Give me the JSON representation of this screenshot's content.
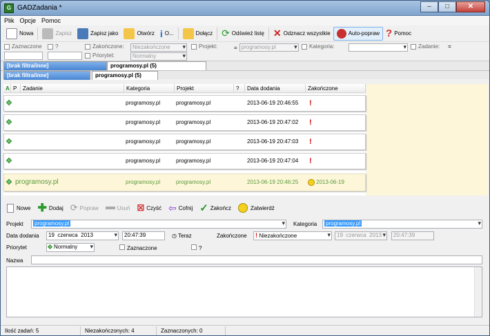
{
  "window": {
    "title": "GADZadania *",
    "controls": {
      "minimize": "–",
      "maximize": "□",
      "close": "✕"
    }
  },
  "menu": [
    "Plik",
    "Opcje",
    "Pomoc"
  ],
  "toolbar": {
    "new": "Nowa",
    "save": "Zapisz",
    "save_as": "Zapisz jako",
    "open": "Otwórz",
    "about": "O...",
    "attach": "Dołącz",
    "refresh": "Odśwież listę",
    "mark_all": "Odznacz wszystkie",
    "autocorrect": "Auto-popraw",
    "help": "Pomoc"
  },
  "filters": {
    "checked_label": "Zaznaczone",
    "question_label": "?",
    "finished_label": "Zakończone:",
    "finished_value": "Niezakończone",
    "project_label": "Projekt:",
    "project_eq": "=",
    "project_value": "programosy.pl",
    "category_label": "Kategoria:",
    "task_label": "Zadanie:",
    "task_eq": "=",
    "priority_label": "Priorytet:",
    "priority_value": "Normalny"
  },
  "tabs_outer": [
    "[brak filtra/inne]",
    "programosy.pl (5)"
  ],
  "tabs_inner": [
    "[brak filtra/inne]",
    "programosy.pl (5)"
  ],
  "columns": [
    "A",
    "P",
    "Zadanie",
    "Kategoria",
    "Projekt",
    "?",
    "Data dodania",
    "Zakończone"
  ],
  "rows": [
    {
      "task": "",
      "category": "programosy.pl",
      "project": "programosy.pl",
      "added": "2013-06-19 20:46:55",
      "finished": "!"
    },
    {
      "task": "",
      "category": "programosy.pl",
      "project": "programosy.pl",
      "added": "2013-06-19 20:47:02",
      "finished": "!"
    },
    {
      "task": "",
      "category": "programosy.pl",
      "project": "programosy.pl",
      "added": "2013-06-19 20:47:03",
      "finished": "!"
    },
    {
      "task": "",
      "category": "programosy.pl",
      "project": "programosy.pl",
      "added": "2013-06-19 20:47:04",
      "finished": "!"
    },
    {
      "task": "programosy.pl",
      "category": "programosy.pl",
      "project": "programosy.pl",
      "added": "2013-06-19 20:46:25",
      "finished": "2013-06-19"
    }
  ],
  "editor_toolbar": {
    "new": "Nowe",
    "add": "Dodaj",
    "fix": "Popraw",
    "delete": "Usuń",
    "clear": "Czyść",
    "undo": "Cofnij",
    "finish": "Zakończ",
    "approve": "Zatwierdź"
  },
  "form": {
    "project_label": "Projekt",
    "project_value": "programosy.pl",
    "category_label": "Kategoria",
    "category_value": "programosy.pl",
    "date_label": "Data dodania",
    "date_day": "19",
    "date_month": "czerwca",
    "date_year": "2013",
    "time_value": "20:47:39",
    "now_label": "Teraz",
    "finished_label": "Zakończone",
    "finished_value": "Niezakończone",
    "finished_day": "19",
    "finished_month": "czerwca",
    "finished_year": "2013",
    "finished_time": "20:47:39",
    "priority_label": "Priorytet",
    "priority_value": "Normalny",
    "checked_label": "Zaznaczone",
    "question_label": "?",
    "name_label": "Nazwa",
    "name_value": ""
  },
  "status": {
    "count": "Ilość zadań: 5",
    "unfinished": "Niezakończonych: 4",
    "checked": "Zaznaczonych: 0"
  }
}
